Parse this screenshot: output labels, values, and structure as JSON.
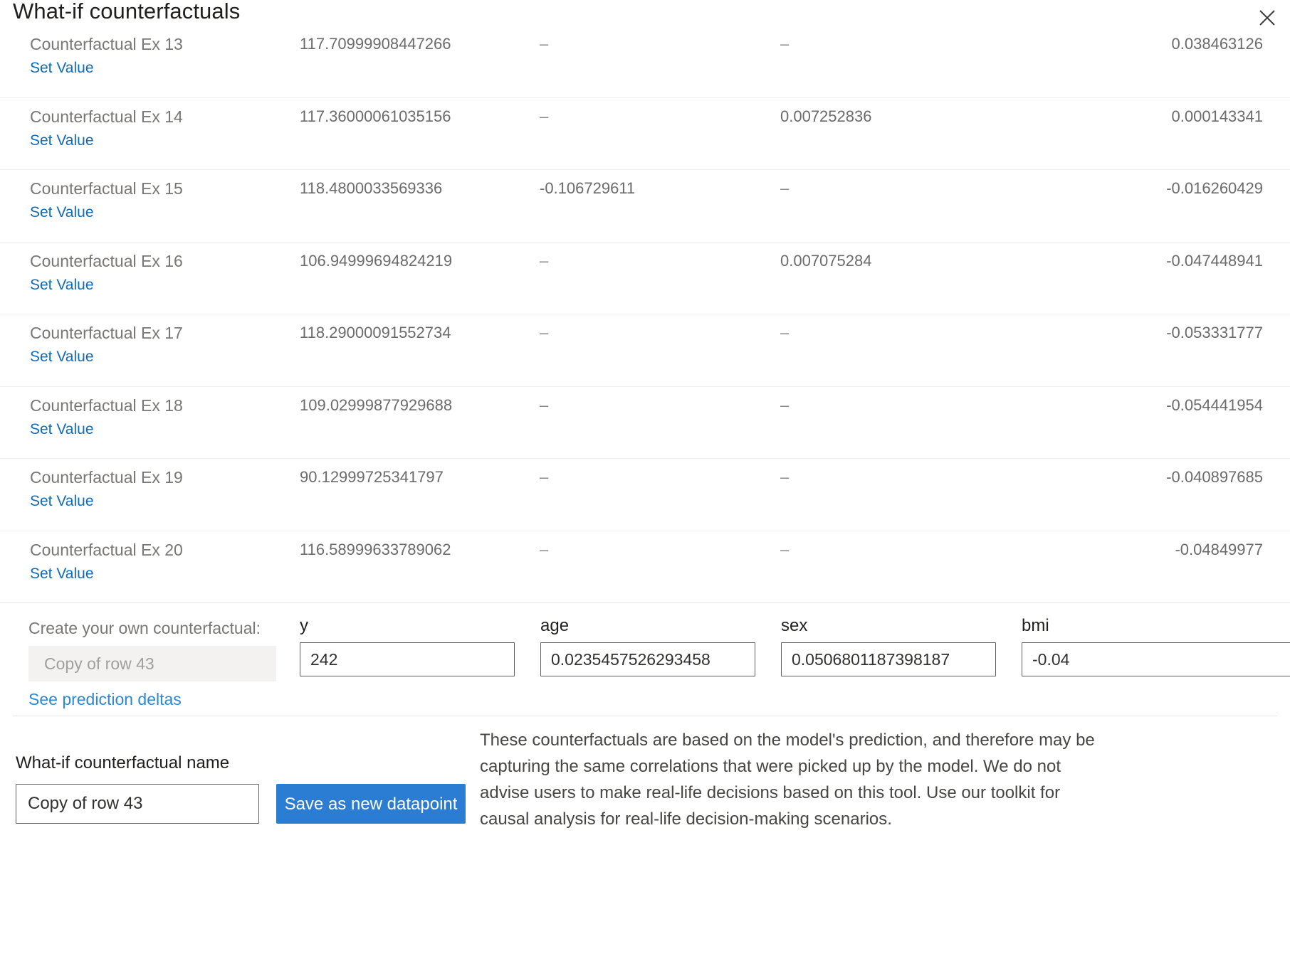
{
  "header": {
    "title": "What-if counterfactuals",
    "close_icon": "close-icon"
  },
  "table": {
    "set_value_label": "Set Value",
    "dash": "–",
    "rows": [
      {
        "name": "Counterfactual Ex 13",
        "c1": "117.70999908447266",
        "c2": "–",
        "c3": "–",
        "c4": "0.038463126"
      },
      {
        "name": "Counterfactual Ex 14",
        "c1": "117.36000061035156",
        "c2": "–",
        "c3": "0.007252836",
        "c4": "0.000143341"
      },
      {
        "name": "Counterfactual Ex 15",
        "c1": "118.4800033569336",
        "c2": "-0.106729611",
        "c3": "–",
        "c4": "-0.016260429"
      },
      {
        "name": "Counterfactual Ex 16",
        "c1": "106.94999694824219",
        "c2": "–",
        "c3": "0.007075284",
        "c4": "-0.047448941"
      },
      {
        "name": "Counterfactual Ex 17",
        "c1": "118.29000091552734",
        "c2": "–",
        "c3": "–",
        "c4": "-0.053331777"
      },
      {
        "name": "Counterfactual Ex 18",
        "c1": "109.02999877929688",
        "c2": "–",
        "c3": "–",
        "c4": "-0.054441954"
      },
      {
        "name": "Counterfactual Ex 19",
        "c1": "90.12999725341797",
        "c2": "–",
        "c3": "–",
        "c4": "-0.040897685"
      },
      {
        "name": "Counterfactual Ex 20",
        "c1": "116.58999633789062",
        "c2": "–",
        "c3": "–",
        "c4": "-0.04849977"
      }
    ]
  },
  "create": {
    "label": "Create your own counterfactual:",
    "row_name_value": "Copy of row 43",
    "see_deltas_label": "See prediction deltas",
    "fields": [
      {
        "label": "y",
        "value": "242"
      },
      {
        "label": "age",
        "value": "0.0235457526293458"
      },
      {
        "label": "sex",
        "value": "0.0506801187398187"
      },
      {
        "label": "bmi",
        "value": "-0.04"
      }
    ]
  },
  "footer": {
    "name_label": "What-if counterfactual name",
    "name_value": "Copy of row 43",
    "save_label": "Save as new datapoint",
    "disclaimer": "These counterfactuals are based on the model's prediction, and therefore may be capturing the same correlations that were picked up by the model. We do not advise users to make real-life decisions based on this tool. Use our toolkit for causal analysis for real-life decision-making scenarios."
  },
  "colors": {
    "link": "#0f6cbd",
    "accent": "#2b7cd3",
    "text": "#201f1e",
    "muted": "#6b6b6b"
  }
}
